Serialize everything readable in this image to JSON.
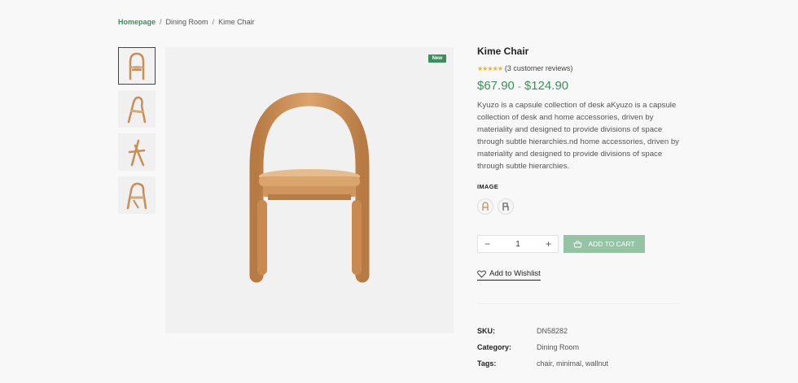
{
  "breadcrumb": {
    "items": [
      "Homepage",
      "Dining Room",
      "Kime Chair"
    ],
    "separator": "/"
  },
  "gallery": {
    "thumbnails": [
      "chair-front-thumb",
      "chair-side-thumb",
      "chair-folded-thumb",
      "chair-angle-thumb"
    ],
    "badge": "New"
  },
  "product": {
    "title": "Kime Chair",
    "stars": "★★★★★",
    "reviews": "(3 customer reviews)",
    "price_low": "$67.90",
    "price_sep": "-",
    "price_high": "$124.90",
    "description": "Kyuzo is a capsule collection of desk aKyuzo is a capsule collection of desk and home accessories, driven by materiality and designed to provide divisions of space through subtle hierarchies.nd home accessories, driven by materiality and designed to provide divisions of space through subtle hierarchies.",
    "image_label": "IMAGE",
    "quantity": "1",
    "qty_minus": "−",
    "qty_plus": "+",
    "add_to_cart": "ADD TO CART",
    "wishlist": "Add to Wishlist"
  },
  "meta": {
    "sku_label": "SKU:",
    "sku": "DN58282",
    "category_label": "Category:",
    "category": "Dining Room",
    "tags_label": "Tags:",
    "tags": "chair, minimal, wallnut"
  },
  "colors": {
    "accent": "#3c8f5c",
    "cart_button": "#95c4a4",
    "stars": "#f2b01e"
  }
}
